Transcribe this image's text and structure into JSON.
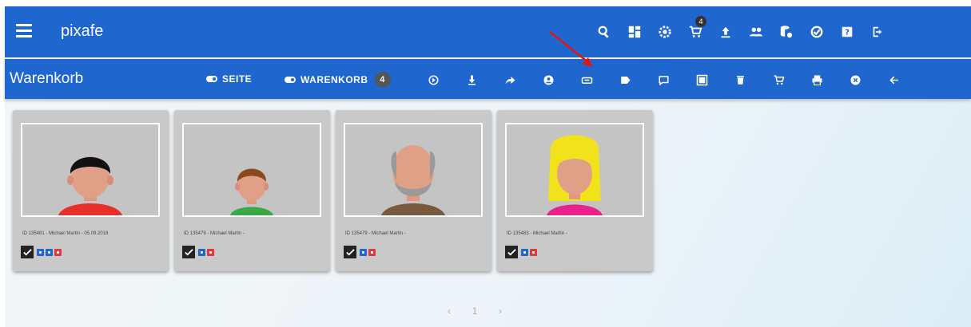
{
  "topbar": {
    "app_title": "pixafe",
    "cart_count": "4",
    "icons": [
      "search-icon",
      "dashboard-icon",
      "settings-icon",
      "cart-icon",
      "upload-icon",
      "users-icon",
      "database-settings-icon",
      "check-circle-icon",
      "help-icon",
      "logout-icon"
    ]
  },
  "subbar": {
    "title": "Warenkorb",
    "seite_label": "SEITE",
    "warenkorb_label": "WARENKORB",
    "warenkorb_count": "4",
    "icons": [
      "play-circle-icon",
      "download-icon",
      "share-icon",
      "account-icon",
      "link-card-icon",
      "label-icon",
      "comment-icon",
      "image-frame-icon",
      "delete-icon",
      "remove-cart-icon",
      "print-icon",
      "cancel-icon",
      "back-arrow-icon"
    ]
  },
  "cards": [
    {
      "caption": "ID 135481 - Michael Martin - 05.09.2018",
      "hair": "#111111",
      "shirt": "#e8302a",
      "style": "man-short"
    },
    {
      "caption": "ID 135479 - Michael Martin -",
      "hair": "#8a4a1c",
      "shirt": "#3aa845",
      "style": "boy"
    },
    {
      "caption": "ID 135479 - Michael Martin -",
      "hair": "#9a9a9a",
      "shirt": "#7a5a3e",
      "style": "old-man"
    },
    {
      "caption": "ID 135483 - Michael Martin -",
      "hair": "#f2e21c",
      "shirt": "#e8228a",
      "style": "woman"
    }
  ],
  "pagination": {
    "prev": "‹",
    "page": "1",
    "next": "›"
  },
  "colors": {
    "primary": "#1f66cf",
    "annotation_arrow": "#e01616",
    "tag_blue": "#1f66cf",
    "tag_red": "#e03a3a"
  }
}
